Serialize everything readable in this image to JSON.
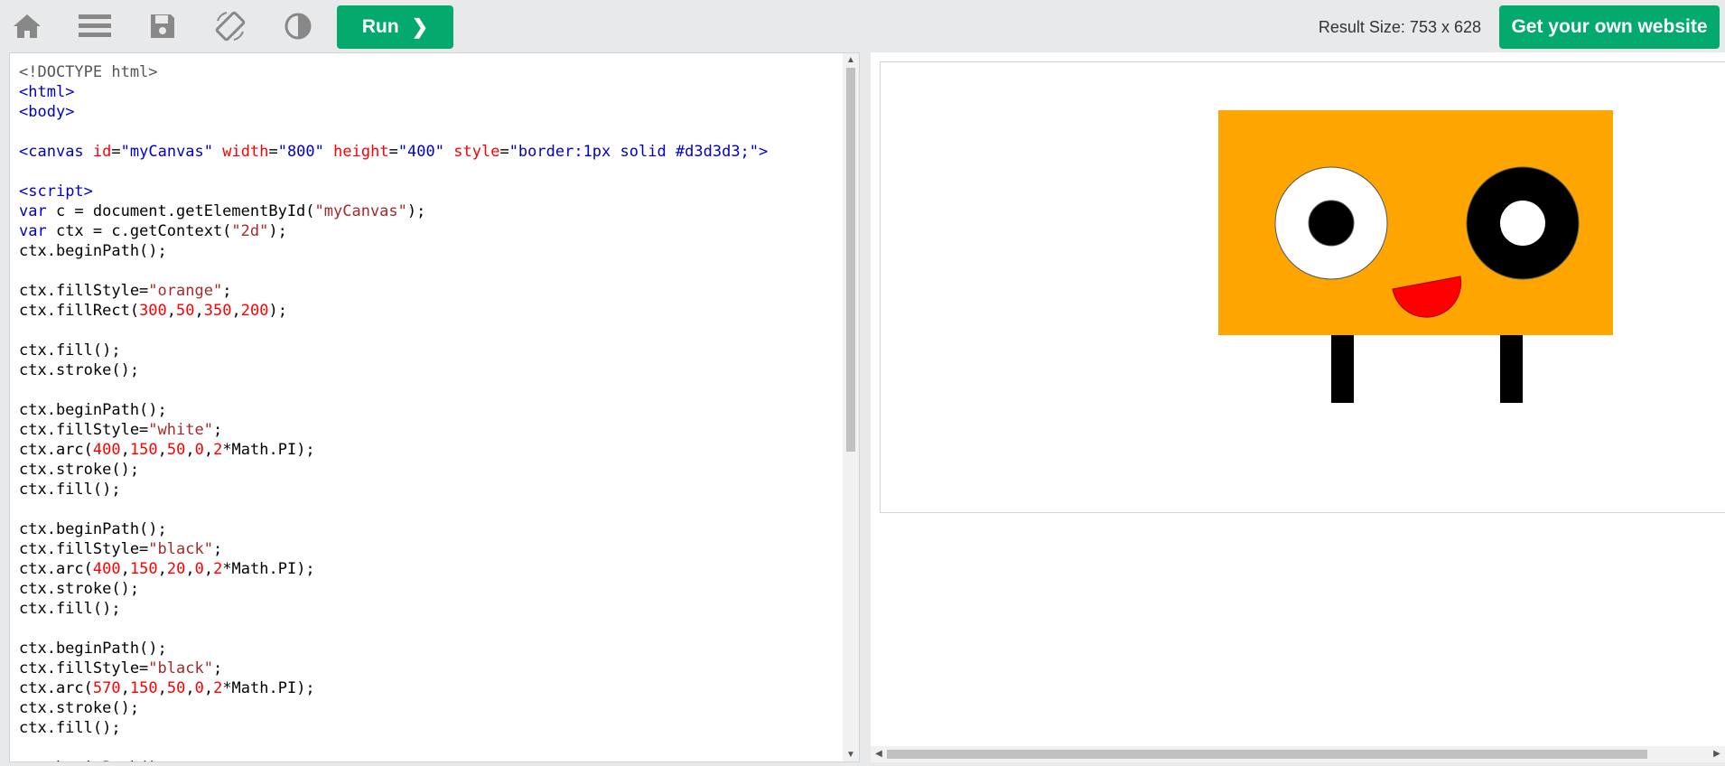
{
  "toolbar": {
    "icons": [
      "home-icon",
      "menu-icon",
      "save-icon",
      "rotate-icon",
      "contrast-icon"
    ],
    "run_label": "Run",
    "run_chevron": "❯",
    "result_size_text": "Result Size: 753 x 628",
    "cta_label": "Get your own website",
    "accent": "#04aa6d"
  },
  "editor": {
    "lines": [
      [
        [
          "doc",
          "<!DOCTYPE html>"
        ]
      ],
      [
        [
          "br",
          "<"
        ],
        [
          "tag",
          "html"
        ],
        [
          "br",
          ">"
        ]
      ],
      [
        [
          "br",
          "<"
        ],
        [
          "tag",
          "body"
        ],
        [
          "br",
          ">"
        ]
      ],
      [],
      [
        [
          "br",
          "<"
        ],
        [
          "tag",
          "canvas"
        ],
        [
          "plain",
          " "
        ],
        [
          "attr",
          "id"
        ],
        [
          "plain",
          "="
        ],
        [
          "val",
          "\"myCanvas\""
        ],
        [
          "plain",
          " "
        ],
        [
          "attr",
          "width"
        ],
        [
          "plain",
          "="
        ],
        [
          "val",
          "\"800\""
        ],
        [
          "plain",
          " "
        ],
        [
          "attr",
          "height"
        ],
        [
          "plain",
          "="
        ],
        [
          "val",
          "\"400\""
        ],
        [
          "plain",
          " "
        ],
        [
          "attr",
          "style"
        ],
        [
          "plain",
          "="
        ],
        [
          "val",
          "\"border:1px solid #d3d3d3;\""
        ],
        [
          "br",
          ">"
        ]
      ],
      [],
      [
        [
          "br",
          "<"
        ],
        [
          "tag",
          "script"
        ],
        [
          "br",
          ">"
        ]
      ],
      [
        [
          "kw",
          "var"
        ],
        [
          "plain",
          " c = document.getElementById("
        ],
        [
          "str",
          "\"myCanvas\""
        ],
        [
          "plain",
          ");"
        ]
      ],
      [
        [
          "kw",
          "var"
        ],
        [
          "plain",
          " ctx = c.getContext("
        ],
        [
          "str",
          "\"2d\""
        ],
        [
          "plain",
          ");"
        ]
      ],
      [
        [
          "plain",
          "ctx.beginPath();"
        ]
      ],
      [],
      [
        [
          "plain",
          "ctx.fillStyle="
        ],
        [
          "str",
          "\"orange\""
        ],
        [
          "plain",
          ";"
        ]
      ],
      [
        [
          "plain",
          "ctx.fillRect("
        ],
        [
          "num",
          "300"
        ],
        [
          "plain",
          ","
        ],
        [
          "num",
          "50"
        ],
        [
          "plain",
          ","
        ],
        [
          "num",
          "350"
        ],
        [
          "plain",
          ","
        ],
        [
          "num",
          "200"
        ],
        [
          "plain",
          ");"
        ]
      ],
      [],
      [
        [
          "plain",
          "ctx.fill();"
        ]
      ],
      [
        [
          "plain",
          "ctx.stroke();"
        ]
      ],
      [],
      [
        [
          "plain",
          "ctx.beginPath();"
        ]
      ],
      [
        [
          "plain",
          "ctx.fillStyle="
        ],
        [
          "str",
          "\"white\""
        ],
        [
          "plain",
          ";"
        ]
      ],
      [
        [
          "plain",
          "ctx.arc("
        ],
        [
          "num",
          "400"
        ],
        [
          "plain",
          ","
        ],
        [
          "num",
          "150"
        ],
        [
          "plain",
          ","
        ],
        [
          "num",
          "50"
        ],
        [
          "plain",
          ","
        ],
        [
          "num",
          "0"
        ],
        [
          "plain",
          ","
        ],
        [
          "num",
          "2"
        ],
        [
          "plain",
          "*Math.PI);"
        ]
      ],
      [
        [
          "plain",
          "ctx.stroke();"
        ]
      ],
      [
        [
          "plain",
          "ctx.fill();"
        ]
      ],
      [],
      [
        [
          "plain",
          "ctx.beginPath();"
        ]
      ],
      [
        [
          "plain",
          "ctx.fillStyle="
        ],
        [
          "str",
          "\"black\""
        ],
        [
          "plain",
          ";"
        ]
      ],
      [
        [
          "plain",
          "ctx.arc("
        ],
        [
          "num",
          "400"
        ],
        [
          "plain",
          ","
        ],
        [
          "num",
          "150"
        ],
        [
          "plain",
          ","
        ],
        [
          "num",
          "20"
        ],
        [
          "plain",
          ","
        ],
        [
          "num",
          "0"
        ],
        [
          "plain",
          ","
        ],
        [
          "num",
          "2"
        ],
        [
          "plain",
          "*Math.PI);"
        ]
      ],
      [
        [
          "plain",
          "ctx.stroke();"
        ]
      ],
      [
        [
          "plain",
          "ctx.fill();"
        ]
      ],
      [],
      [
        [
          "plain",
          "ctx.beginPath();"
        ]
      ],
      [
        [
          "plain",
          "ctx.fillStyle="
        ],
        [
          "str",
          "\"black\""
        ],
        [
          "plain",
          ";"
        ]
      ],
      [
        [
          "plain",
          "ctx.arc("
        ],
        [
          "num",
          "570"
        ],
        [
          "plain",
          ","
        ],
        [
          "num",
          "150"
        ],
        [
          "plain",
          ","
        ],
        [
          "num",
          "50"
        ],
        [
          "plain",
          ","
        ],
        [
          "num",
          "0"
        ],
        [
          "plain",
          ","
        ],
        [
          "num",
          "2"
        ],
        [
          "plain",
          "*Math.PI);"
        ]
      ],
      [
        [
          "plain",
          "ctx.stroke();"
        ]
      ],
      [
        [
          "plain",
          "ctx.fill();"
        ]
      ],
      [],
      [
        [
          "plain",
          "ctx.beginPath();"
        ]
      ]
    ]
  },
  "scene": {
    "canvas_border_color": "#d3d3d3",
    "body_color": "orange",
    "eye_white": "white",
    "pupil_black": "black",
    "mouth_color": "red"
  }
}
